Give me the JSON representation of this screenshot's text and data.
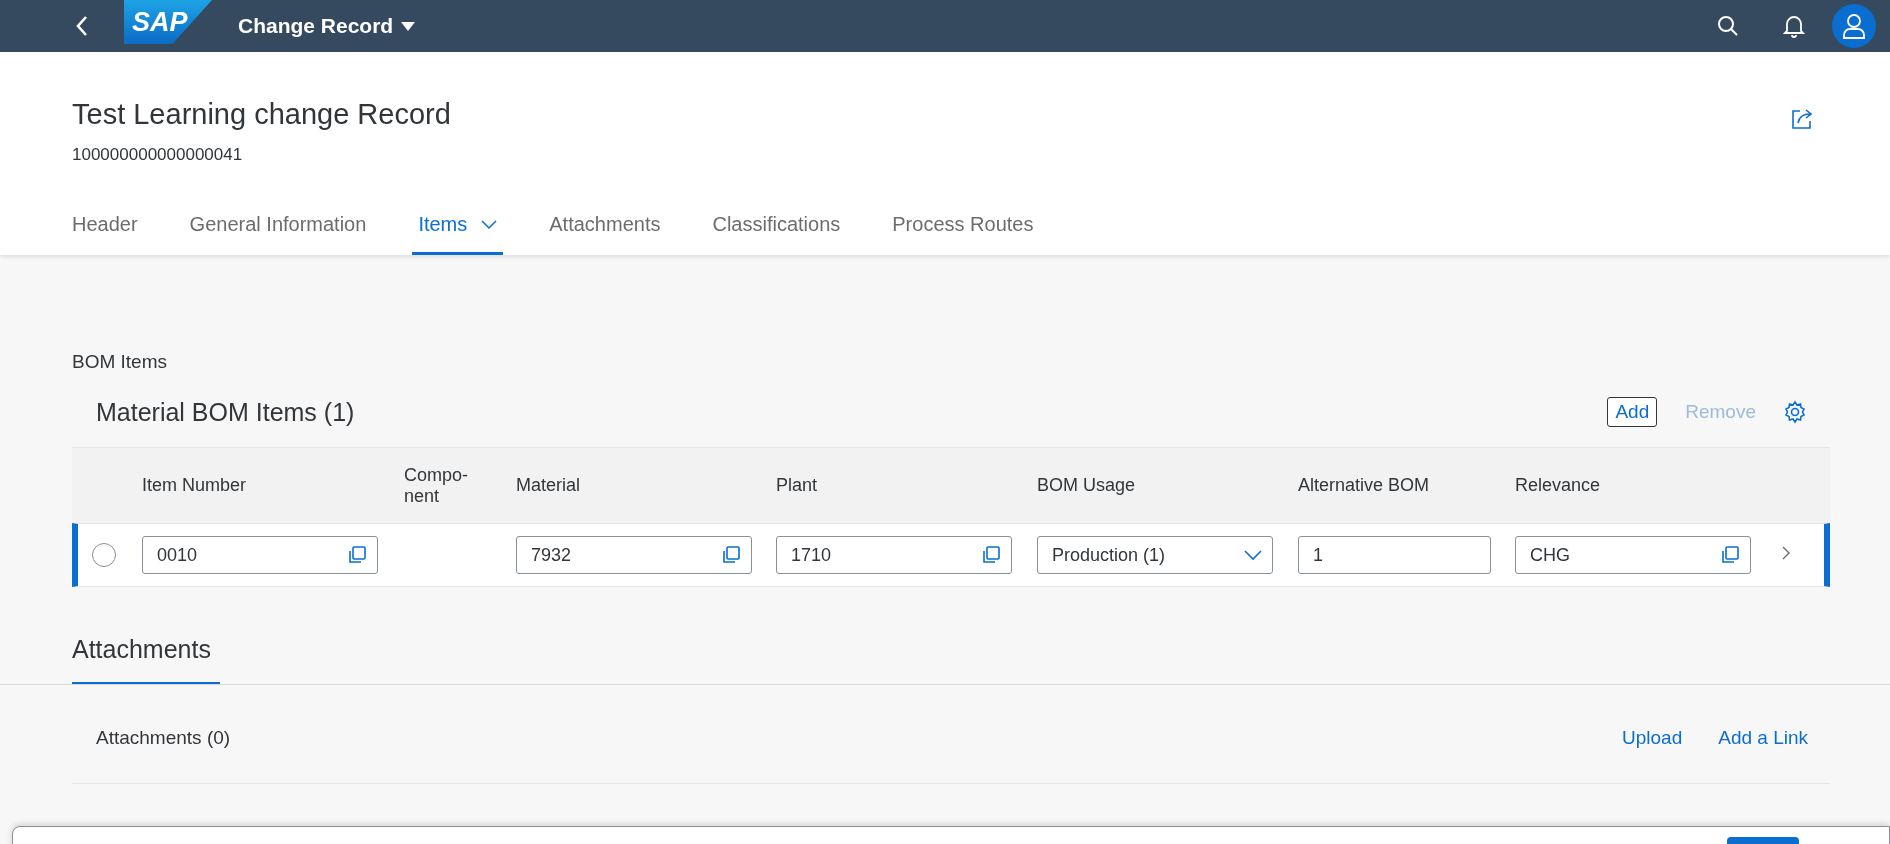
{
  "shell": {
    "logo": "SAP",
    "title": "Change Record"
  },
  "object": {
    "title": "Test Learning change Record",
    "id": "100000000000000041"
  },
  "tabs": [
    {
      "label": "Header",
      "selected": false,
      "has_menu": false
    },
    {
      "label": "General Information",
      "selected": false,
      "has_menu": false
    },
    {
      "label": "Items",
      "selected": true,
      "has_menu": true
    },
    {
      "label": "Attachments",
      "selected": false,
      "has_menu": false
    },
    {
      "label": "Classifications",
      "selected": false,
      "has_menu": false
    },
    {
      "label": "Process Routes",
      "selected": false,
      "has_menu": false
    }
  ],
  "bom": {
    "section_title": "BOM Items",
    "table_title": "Material BOM Items (1)",
    "actions": [
      {
        "label": "Add",
        "disabled": false,
        "kind": "outlined"
      },
      {
        "label": "Remove",
        "disabled": true,
        "kind": "plain"
      }
    ],
    "columns": [
      "Item Number",
      "Compo-\nnent",
      "Material",
      "Plant",
      "BOM Usage",
      "Alternative BOM",
      "Relevance"
    ],
    "rows": [
      {
        "selected": false,
        "navigated": true,
        "cells": [
          {
            "kind": "value_help",
            "value": "0010"
          },
          {
            "kind": "empty"
          },
          {
            "kind": "value_help",
            "value": "7932"
          },
          {
            "kind": "value_help",
            "value": "1710"
          },
          {
            "kind": "select",
            "value": "Production (1)"
          },
          {
            "kind": "input",
            "value": "1"
          },
          {
            "kind": "value_help",
            "value": "CHG"
          }
        ]
      }
    ]
  },
  "attachments": {
    "section_title": "Attachments",
    "list_title": "Attachments (0)",
    "actions": [
      "Upload",
      "Add a Link"
    ]
  }
}
